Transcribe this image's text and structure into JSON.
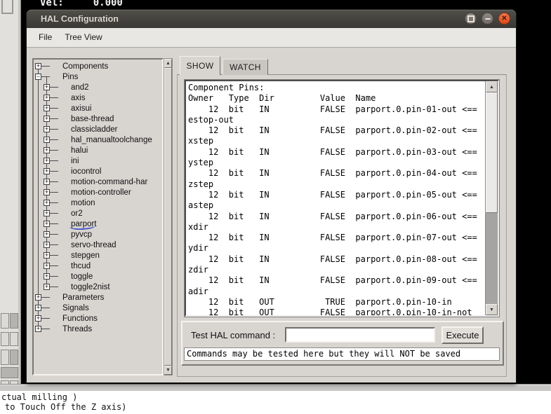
{
  "background": {
    "vel_label": "Vel:",
    "vel_value": "0.000",
    "bottom_lines": [
      "ctual milling )",
      "to Touch Off the Z axis)"
    ]
  },
  "window": {
    "title": "HAL Configuration",
    "controls": [
      {
        "name": "maximize",
        "icon": "maximize-icon"
      },
      {
        "name": "minimize",
        "icon": "minimize-icon"
      },
      {
        "name": "close",
        "icon": "close-icon"
      }
    ],
    "menu": [
      "File",
      "Tree View"
    ]
  },
  "tabs": [
    {
      "label": "SHOW",
      "active": true
    },
    {
      "label": "WATCH",
      "active": false
    }
  ],
  "tree": {
    "items": [
      {
        "label": "Components",
        "level": 0,
        "glyph": "+"
      },
      {
        "label": "Pins",
        "level": 0,
        "glyph": "-"
      },
      {
        "label": "and2",
        "level": 1,
        "glyph": "+"
      },
      {
        "label": "axis",
        "level": 1,
        "glyph": "+"
      },
      {
        "label": "axisui",
        "level": 1,
        "glyph": "+"
      },
      {
        "label": "base-thread",
        "level": 1,
        "glyph": "+"
      },
      {
        "label": "classicladder",
        "level": 1,
        "glyph": "+"
      },
      {
        "label": "hal_manualtoolchange",
        "level": 1,
        "glyph": "+"
      },
      {
        "label": "halui",
        "level": 1,
        "glyph": "+"
      },
      {
        "label": "ini",
        "level": 1,
        "glyph": "+"
      },
      {
        "label": "iocontrol",
        "level": 1,
        "glyph": "+"
      },
      {
        "label": "motion-command-har",
        "level": 1,
        "glyph": "+"
      },
      {
        "label": "motion-controller",
        "level": 1,
        "glyph": "+"
      },
      {
        "label": "motion",
        "level": 1,
        "glyph": "+"
      },
      {
        "label": "or2",
        "level": 1,
        "glyph": "+"
      },
      {
        "label": "parport",
        "level": 1,
        "glyph": "+",
        "underlined": true
      },
      {
        "label": "pyvcp",
        "level": 1,
        "glyph": "+"
      },
      {
        "label": "servo-thread",
        "level": 1,
        "glyph": "+"
      },
      {
        "label": "stepgen",
        "level": 1,
        "glyph": "+"
      },
      {
        "label": "thcud",
        "level": 1,
        "glyph": "+"
      },
      {
        "label": "toggle",
        "level": 1,
        "glyph": "+"
      },
      {
        "label": "toggle2nist",
        "level": 1,
        "glyph": "+"
      },
      {
        "label": "Parameters",
        "level": 0,
        "glyph": "+"
      },
      {
        "label": "Signals",
        "level": 0,
        "glyph": "+"
      },
      {
        "label": "Functions",
        "level": 0,
        "glyph": "+"
      },
      {
        "label": "Threads",
        "level": 0,
        "glyph": "+"
      }
    ]
  },
  "show_output": {
    "lines": [
      "Component Pins:",
      "Owner   Type  Dir         Value  Name",
      "    12  bit   IN          FALSE  parport.0.pin-01-out <==",
      "estop-out",
      "    12  bit   IN          FALSE  parport.0.pin-02-out <==",
      "xstep",
      "    12  bit   IN          FALSE  parport.0.pin-03-out <==",
      "ystep",
      "    12  bit   IN          FALSE  parport.0.pin-04-out <==",
      "zstep",
      "    12  bit   IN          FALSE  parport.0.pin-05-out <==",
      "astep",
      "    12  bit   IN          FALSE  parport.0.pin-06-out <==",
      "xdir",
      "    12  bit   IN          FALSE  parport.0.pin-07-out <==",
      "ydir",
      "    12  bit   IN          FALSE  parport.0.pin-08-out <==",
      "zdir",
      "    12  bit   IN          FALSE  parport.0.pin-09-out <==",
      "adir",
      "    12  bit   OUT          TRUE  parport.0.pin-10-in",
      "    12  bit   OUT         FALSE  parport.0.pin-10-in-not"
    ]
  },
  "command_panel": {
    "label": "Test HAL command :",
    "input_value": "",
    "button_label": "Execute",
    "note": "Commands may be tested here but they will NOT be saved"
  },
  "colors": {
    "titlebar_bg": "#3a3834",
    "close_button": "#dd4814",
    "window_bg": "#d8d5d1",
    "annotation_ink": "#4856c8",
    "backdrop": "#000000"
  }
}
